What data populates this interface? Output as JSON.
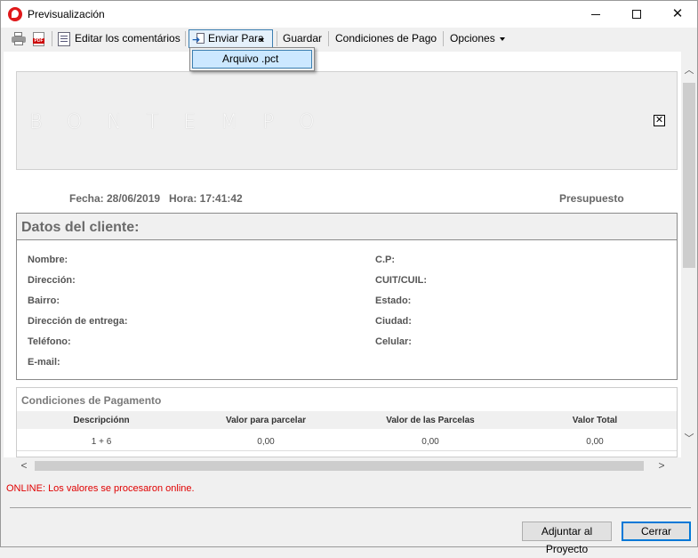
{
  "window": {
    "title": "Previsualización"
  },
  "toolbar": {
    "edit_label": "Editar los comentários",
    "send_label": "Enviar Para",
    "save_label": "Guardar",
    "payment_label": "Condiciones de Pago",
    "options_label": "Opciones"
  },
  "send_menu": {
    "items": [
      {
        "label": "Arquivo .pct"
      }
    ]
  },
  "document": {
    "logo": "BONTEMPO",
    "date_label": "Fecha: 28/06/2019",
    "time_label": "Hora: 17:41:42",
    "doc_type": "Presupuesto",
    "client": {
      "title": "Datos del cliente:",
      "left_fields": [
        "Nombre:",
        "Dirección:",
        "Bairro:",
        "Dirección de entrega:",
        "Teléfono:",
        "E-mail:"
      ],
      "right_fields": [
        "C.P:",
        "CUIT/CUIL:",
        "Estado:",
        "Ciudad:",
        "Celular:"
      ]
    },
    "conditions": {
      "title": "Condiciones de Pagamento",
      "columns": [
        "Descripciónn",
        "Valor para parcelar",
        "Valor de las Parcelas",
        "Valor Total"
      ],
      "rows": [
        [
          "1 + 6",
          "0,00",
          "0,00",
          "0,00"
        ]
      ]
    }
  },
  "status": {
    "message": "ONLINE: Los valores se procesaron online.",
    "color": "#e00000"
  },
  "buttons": {
    "attach": "Adjuntar al Proyecto",
    "close": "Cerrar"
  },
  "icons": [
    "app-icon",
    "printer-icon",
    "pdf-icon",
    "edit-comments-icon",
    "send-to-icon",
    "close-box-icon"
  ]
}
